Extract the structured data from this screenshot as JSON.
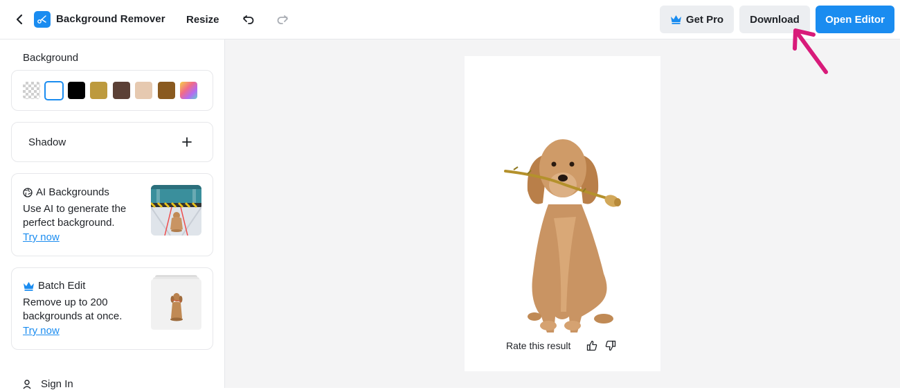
{
  "header": {
    "back_icon": "chevron-left-icon",
    "app_icon": "scissors-icon",
    "app_title": "Background Remover",
    "resize_label": "Resize",
    "undo_icon": "undo-icon",
    "redo_icon": "redo-icon",
    "get_pro_label": "Get Pro",
    "download_label": "Download",
    "open_editor_label": "Open Editor",
    "accent_color": "#1a8cf0"
  },
  "sidebar": {
    "background_title": "Background",
    "swatches": [
      {
        "name": "transparent",
        "color": "transparent"
      },
      {
        "name": "white",
        "color": "#ffffff",
        "selected": true
      },
      {
        "name": "black",
        "color": "#000000"
      },
      {
        "name": "gold",
        "color": "#bd9a3d"
      },
      {
        "name": "dark-brown",
        "color": "#5b4036"
      },
      {
        "name": "beige",
        "color": "#e6c9b0"
      },
      {
        "name": "brown",
        "color": "#8a5a1f"
      },
      {
        "name": "gradient",
        "color": "linear-gradient"
      }
    ],
    "shadow_label": "Shadow",
    "ai_backgrounds": {
      "title": "AI Backgrounds",
      "description": "Use AI to generate the perfect background.",
      "link": "Try now"
    },
    "batch_edit": {
      "title": "Batch Edit",
      "description": "Remove up to 200 backgrounds at once.",
      "link": "Try now"
    },
    "sign_in_label": "Sign In"
  },
  "canvas": {
    "rate_text": "Rate this result",
    "thumbs_up_icon": "thumbs-up-icon",
    "thumbs_down_icon": "thumbs-down-icon"
  },
  "annotation": {
    "arrow_color": "#d81b7a"
  }
}
